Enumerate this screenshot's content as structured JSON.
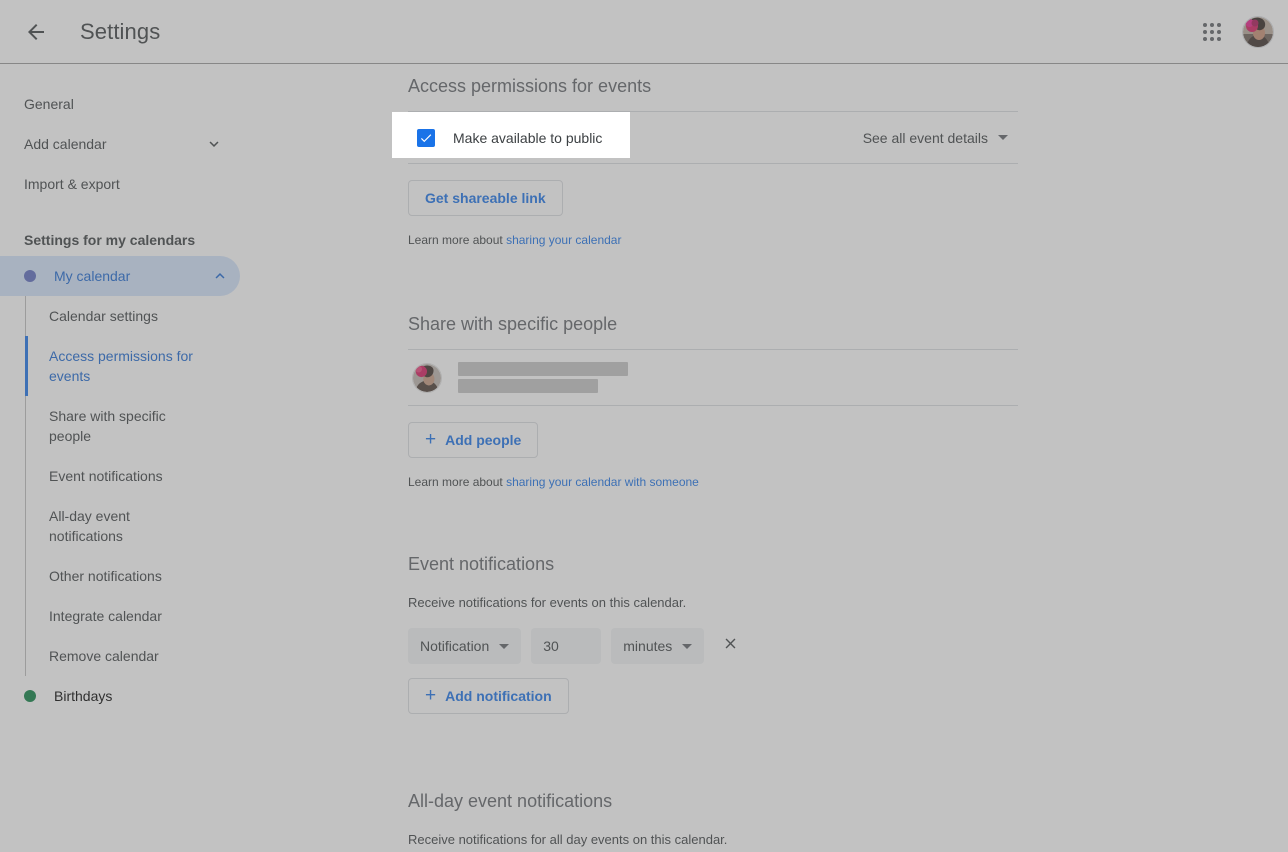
{
  "header": {
    "back_icon": "arrow-back-icon",
    "title": "Settings",
    "apps_icon": "apps-grid-icon",
    "avatar_icon": "user-avatar"
  },
  "sidebar": {
    "nav_items": [
      {
        "label": "General",
        "has_chevron": false
      },
      {
        "label": "Add calendar",
        "has_chevron": true
      },
      {
        "label": "Import & export",
        "has_chevron": false
      }
    ],
    "section_title": "Settings for my calendars",
    "calendars": [
      {
        "label": "My calendar",
        "color": "#5c6bc0",
        "selected": true,
        "expanded": true,
        "sub_items": [
          {
            "label": "Calendar settings",
            "active": false
          },
          {
            "label": "Access permissions for events",
            "active": true
          },
          {
            "label": "Share with specific people",
            "active": false
          },
          {
            "label": "Event notifications",
            "active": false
          },
          {
            "label": "All-day event notifications",
            "active": false
          },
          {
            "label": "Other notifications",
            "active": false
          },
          {
            "label": "Integrate calendar",
            "active": false
          },
          {
            "label": "Remove calendar",
            "active": false
          }
        ]
      },
      {
        "label": "Birthdays",
        "color": "#0b8043",
        "selected": false,
        "expanded": false,
        "sub_items": []
      }
    ]
  },
  "main": {
    "access": {
      "heading": "Access permissions for events",
      "checkbox_label": "Make available to public",
      "checkbox_checked": true,
      "visibility_value": "See all event details",
      "shareable_link_label": "Get shareable link",
      "learn_prefix": "Learn more about ",
      "learn_link": "sharing your calendar"
    },
    "share": {
      "heading": "Share with specific people",
      "person_name_redacted": true,
      "add_people_label": "Add people",
      "learn_prefix": "Learn more about ",
      "learn_link": "sharing your calendar with someone"
    },
    "event_notifications": {
      "heading": "Event notifications",
      "description": "Receive notifications for events on this calendar.",
      "rows": [
        {
          "type": "Notification",
          "amount": "30",
          "unit": "minutes"
        }
      ],
      "add_label": "Add notification"
    },
    "allday_notifications": {
      "heading": "All-day event notifications",
      "description": "Receive notifications for all day events on this calendar."
    }
  },
  "colors": {
    "accent_blue": "#1a73e8",
    "link_blue": "#1967d2",
    "selected_chip": "#d2e3fc",
    "text_primary": "#3c4043",
    "text_secondary": "#5f6368",
    "divider": "#dadce0"
  }
}
